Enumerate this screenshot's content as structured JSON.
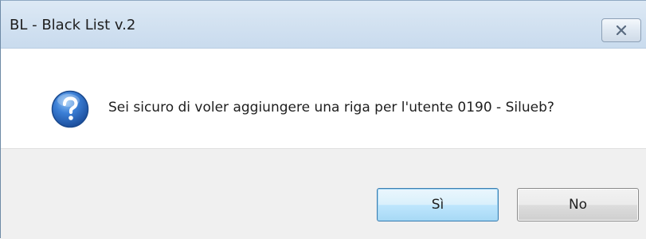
{
  "window": {
    "title": "BL - Black List v.2"
  },
  "dialog": {
    "icon": "question-icon",
    "message": "Sei sicuro di voler aggiungere una riga per l'utente 0190 - Silueb?"
  },
  "buttons": {
    "yes_label": "Sì",
    "no_label": "No"
  },
  "colors": {
    "titlebar": "#d3e2f1",
    "footer": "#f0f0f0",
    "default_button_border": "#3c7fb1",
    "question_icon_blue": "#2a63b8"
  }
}
